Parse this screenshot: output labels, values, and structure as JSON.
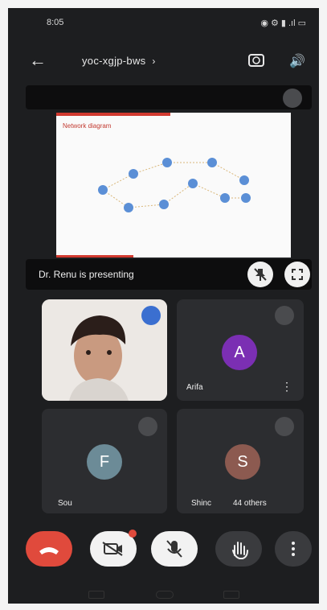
{
  "status": {
    "time": "8:05",
    "icons_right": "◉ ⚙ ▮ .ıl ▭"
  },
  "topbar": {
    "meeting_code": "yoc-xgjp-bws",
    "chevron": "›"
  },
  "slide": {
    "title": "Network diagram"
  },
  "presenting": {
    "text": "Dr. Renu is presenting"
  },
  "participants": [
    {
      "name": "",
      "initial": "",
      "color": ""
    },
    {
      "name": "Arifa",
      "initial": "A",
      "color": "#7b2fb3"
    },
    {
      "name": "Sou",
      "initial": "F",
      "color": "#6c8b97"
    },
    {
      "name": "Shinc",
      "initial": "S",
      "color": "#8c5a50",
      "extra": "44 others"
    }
  ],
  "controls": {
    "end": "end-call-icon",
    "camera": "camera-off-icon",
    "mic": "mic-off-icon",
    "hand": "raise-hand-icon",
    "more": "more-vertical-icon"
  }
}
